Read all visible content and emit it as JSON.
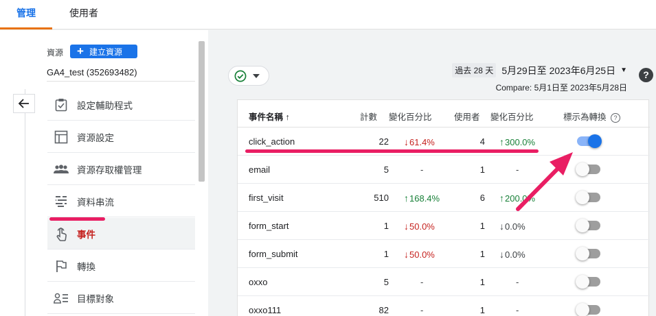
{
  "tabs": [
    {
      "label": "管理"
    },
    {
      "label": "使用者"
    }
  ],
  "nav": {
    "resource_label": "資源",
    "create_button": "建立資源",
    "property_name": "GA4_test (352693482)",
    "items": [
      {
        "label": "設定輔助程式",
        "icon": "clipboard-check-icon"
      },
      {
        "label": "資源設定",
        "icon": "layout-icon"
      },
      {
        "label": "資源存取權管理",
        "icon": "people-icon"
      },
      {
        "label": "資料串流",
        "icon": "data-stream-icon"
      },
      {
        "label": "事件",
        "icon": "touch-icon"
      },
      {
        "label": "轉換",
        "icon": "flag-icon"
      },
      {
        "label": "目標對象",
        "icon": "audience-icon"
      }
    ]
  },
  "date": {
    "preset": "過去 28 天",
    "range": "5月29日至 2023年6月25日",
    "compare": "Compare: 5月1日至 2023年5月28日"
  },
  "table": {
    "headers": {
      "name": "事件名稱 ↑",
      "count": "計數",
      "pct1": "變化百分比",
      "users": "使用者",
      "pct2": "變化百分比",
      "conversion": "標示為轉換"
    },
    "rows": [
      {
        "name": "click_action",
        "count": "22",
        "pct1": "61.4%",
        "pct1_dir": "down",
        "users": "4",
        "pct2": "300.0%",
        "pct2_dir": "up",
        "conversion": true
      },
      {
        "name": "email",
        "count": "5",
        "pct1": "-",
        "pct1_dir": "none",
        "users": "1",
        "pct2": "-",
        "pct2_dir": "none",
        "conversion": false
      },
      {
        "name": "first_visit",
        "count": "510",
        "pct1": "168.4%",
        "pct1_dir": "up",
        "users": "6",
        "pct2": "200.0%",
        "pct2_dir": "up",
        "conversion": false
      },
      {
        "name": "form_start",
        "count": "1",
        "pct1": "50.0%",
        "pct1_dir": "down",
        "users": "1",
        "pct2": "0.0%",
        "pct2_dir": "flat",
        "conversion": false
      },
      {
        "name": "form_submit",
        "count": "1",
        "pct1": "50.0%",
        "pct1_dir": "down",
        "users": "1",
        "pct2": "0.0%",
        "pct2_dir": "flat",
        "conversion": false
      },
      {
        "name": "oxxo",
        "count": "5",
        "pct1": "-",
        "pct1_dir": "none",
        "users": "1",
        "pct2": "-",
        "pct2_dir": "none",
        "conversion": false
      },
      {
        "name": "oxxo111",
        "count": "82",
        "pct1": "-",
        "pct1_dir": "none",
        "users": "1",
        "pct2": "-",
        "pct2_dir": "none",
        "conversion": false
      }
    ]
  },
  "colors": {
    "accent": "#1a73e8",
    "tab_indicator": "#e8710a",
    "annotation": "#e91e63",
    "negative": "#c5221f",
    "positive": "#188038"
  }
}
